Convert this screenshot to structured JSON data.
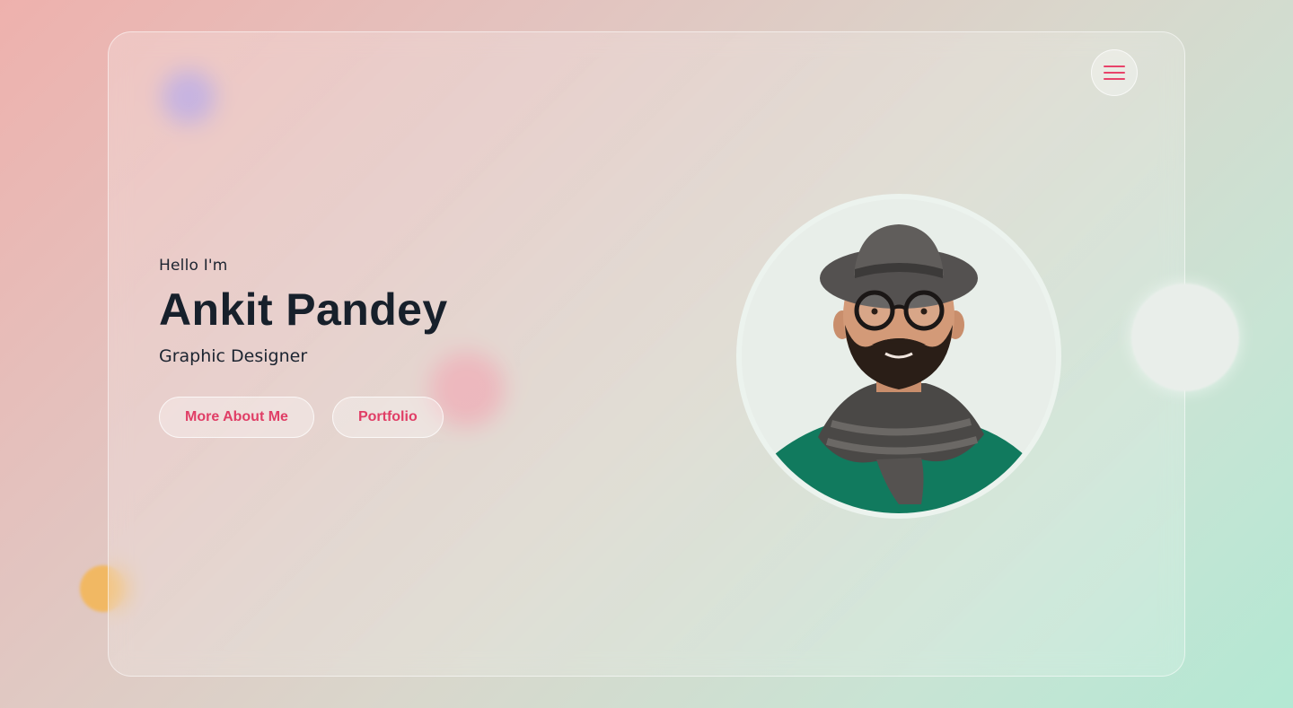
{
  "intro": {
    "greeting": "Hello I'm",
    "name": "Ankit Pandey",
    "role": "Graphic Designer"
  },
  "buttons": {
    "about": "More About Me",
    "portfolio": "Portfolio"
  },
  "menu": {
    "icon": "hamburger-menu-icon"
  },
  "colors": {
    "accent": "#e03e66",
    "name_text": "#17202b",
    "blob_purple": "#b79fd9",
    "blob_orange": "#f1b863",
    "blob_pink": "#eaa5ad"
  }
}
